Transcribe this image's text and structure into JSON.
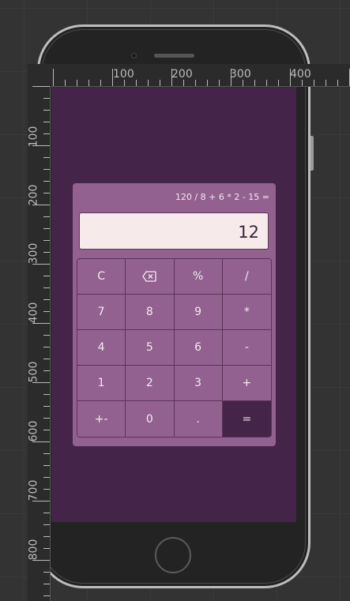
{
  "ruler": {
    "top_labels": [
      "100",
      "200",
      "300",
      "400"
    ],
    "left_labels": [
      "100",
      "200",
      "300",
      "400",
      "500",
      "600",
      "700",
      "800"
    ]
  },
  "calculator": {
    "expression": "120 / 8 + 6 * 2 - 15 =",
    "display_value": "12",
    "keys": [
      {
        "label": "C",
        "name": "clear-button"
      },
      {
        "label": "",
        "name": "backspace-button",
        "icon": "backspace-icon"
      },
      {
        "label": "%",
        "name": "percent-button"
      },
      {
        "label": "/",
        "name": "divide-button"
      },
      {
        "label": "7",
        "name": "digit-7-button"
      },
      {
        "label": "8",
        "name": "digit-8-button"
      },
      {
        "label": "9",
        "name": "digit-9-button"
      },
      {
        "label": "*",
        "name": "multiply-button"
      },
      {
        "label": "4",
        "name": "digit-4-button"
      },
      {
        "label": "5",
        "name": "digit-5-button"
      },
      {
        "label": "6",
        "name": "digit-6-button"
      },
      {
        "label": "-",
        "name": "subtract-button"
      },
      {
        "label": "1",
        "name": "digit-1-button"
      },
      {
        "label": "2",
        "name": "digit-2-button"
      },
      {
        "label": "3",
        "name": "digit-3-button"
      },
      {
        "label": "+",
        "name": "add-button"
      },
      {
        "label": "+-",
        "name": "negate-button"
      },
      {
        "label": "0",
        "name": "digit-0-button"
      },
      {
        "label": ".",
        "name": "decimal-button"
      },
      {
        "label": "=",
        "name": "equals-button"
      }
    ]
  },
  "colors": {
    "canvas": "#333333",
    "screen": "#45244a",
    "calculator_body": "#93618f",
    "display_bg": "#f6ebea",
    "equals_key": "#45244a"
  }
}
